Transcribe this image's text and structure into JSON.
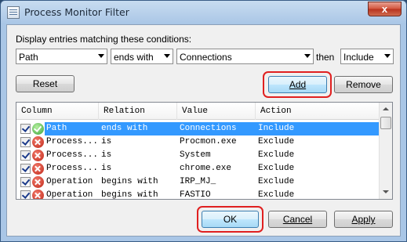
{
  "window": {
    "title": "Process Monitor Filter",
    "close_glyph": "x"
  },
  "filter": {
    "label": "Display entries matching these conditions:",
    "column": "Path",
    "relation": "ends with",
    "value": "Connections",
    "then_label": "then",
    "action": "Include"
  },
  "buttons": {
    "reset": "Reset",
    "add": "Add",
    "remove": "Remove",
    "ok": "OK",
    "cancel": "Cancel",
    "apply": "Apply"
  },
  "table": {
    "columns": [
      "Column",
      "Relation",
      "Value",
      "Action"
    ],
    "rows": [
      {
        "column": "Path",
        "relation": "ends with",
        "value": "Connections",
        "action": "Include",
        "icon": "green-check-icon",
        "checked": true,
        "selected": true
      },
      {
        "column": "Process...",
        "relation": "is",
        "value": "Procmon.exe",
        "action": "Exclude",
        "icon": "red-x-icon",
        "checked": true
      },
      {
        "column": "Process...",
        "relation": "is",
        "value": "System",
        "action": "Exclude",
        "icon": "red-x-icon",
        "checked": true
      },
      {
        "column": "Process...",
        "relation": "is",
        "value": "chrome.exe",
        "action": "Exclude",
        "icon": "red-x-icon",
        "checked": true
      },
      {
        "column": "Operation",
        "relation": "begins with",
        "value": "IRP_MJ_",
        "action": "Exclude",
        "icon": "red-x-icon",
        "checked": true
      },
      {
        "column": "Operation",
        "relation": "begins with",
        "value": "FASTIO",
        "action": "Exclude",
        "icon": "red-x-icon",
        "checked": true
      }
    ]
  },
  "colors": {
    "selection": "#3399ff",
    "highlight_ring": "#e02020",
    "title_bar": "#a9c6e6"
  }
}
